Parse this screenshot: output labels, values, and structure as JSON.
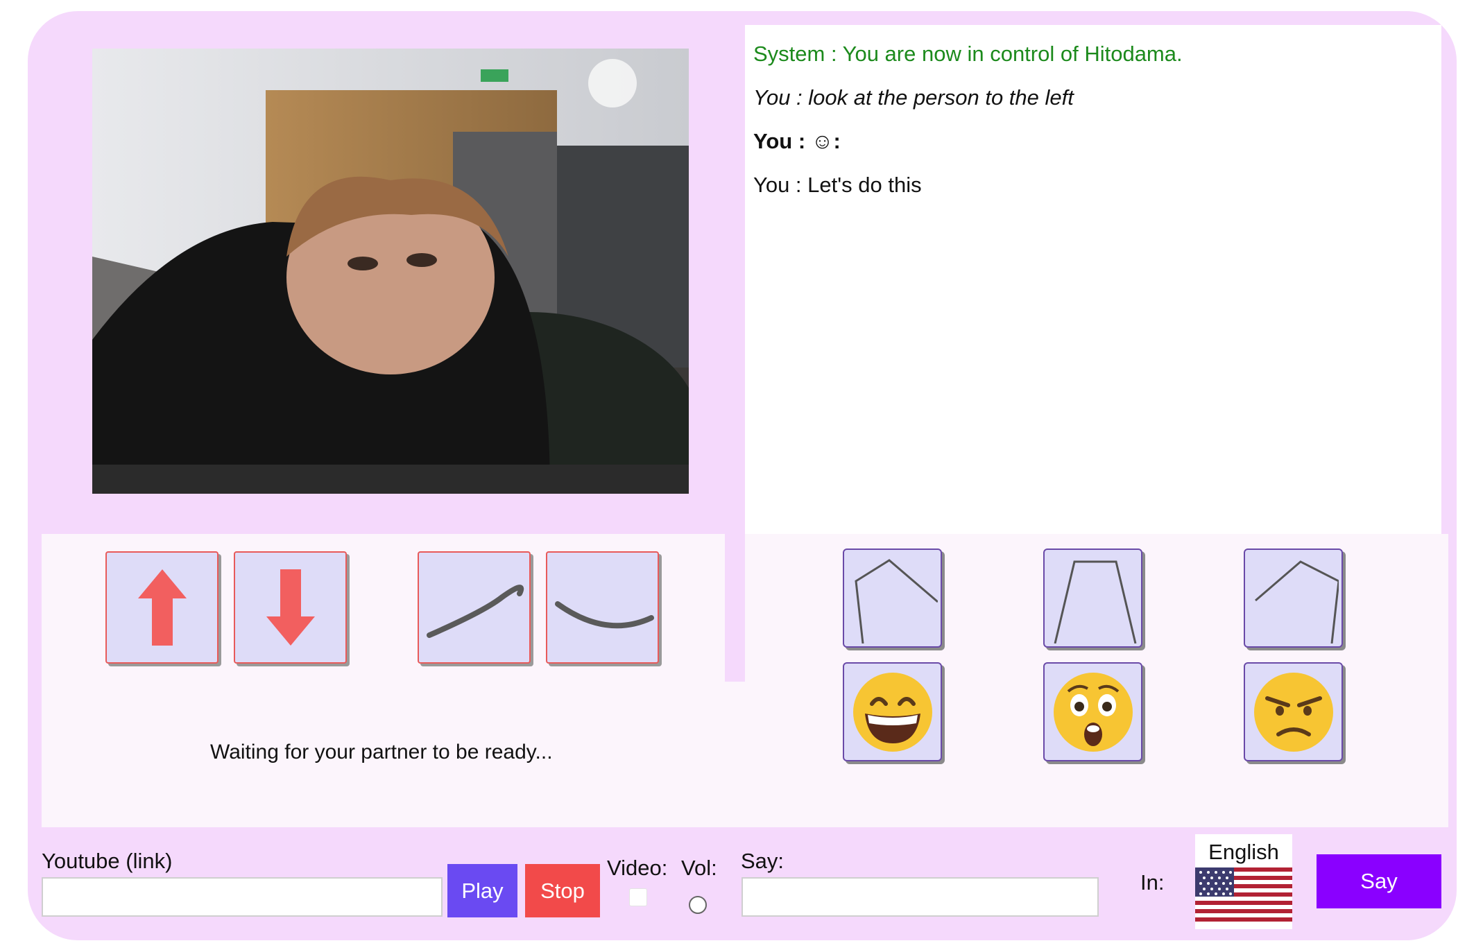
{
  "chat": {
    "lines": [
      "System : You are now in control of Hitodama.",
      "You : look at the person to the left",
      "You : ☺:",
      "You : Let's do this"
    ]
  },
  "controls": {
    "move_buttons": [
      "up-arrow-icon",
      "down-arrow-icon",
      "curve-up-icon",
      "curve-down-icon"
    ],
    "arrow_color": "#f25f5f"
  },
  "status": {
    "waiting_text": "Waiting for your partner to be ready..."
  },
  "expressions": {
    "pose_buttons": [
      "pose-left-icon",
      "pose-center-icon",
      "pose-right-icon"
    ],
    "emoji_buttons": [
      "grinning-face-icon",
      "surprised-face-icon",
      "angry-face-icon"
    ]
  },
  "youtube": {
    "label": "Youtube (link)",
    "value": "",
    "play_label": "Play",
    "stop_label": "Stop"
  },
  "video_toggle": {
    "label": "Video:",
    "checked": false
  },
  "volume": {
    "label": "Vol:"
  },
  "say": {
    "label": "Say:",
    "value": "",
    "in_label": "In:",
    "language": "English",
    "flag": "us-flag-icon",
    "button_label": "Say"
  },
  "colors": {
    "background": "#f5d9fc",
    "panel": "#fcf5fc",
    "play": "#6a4af2",
    "stop": "#f24a4a",
    "say": "#8a00ff",
    "system_text": "#1c8a1c"
  }
}
